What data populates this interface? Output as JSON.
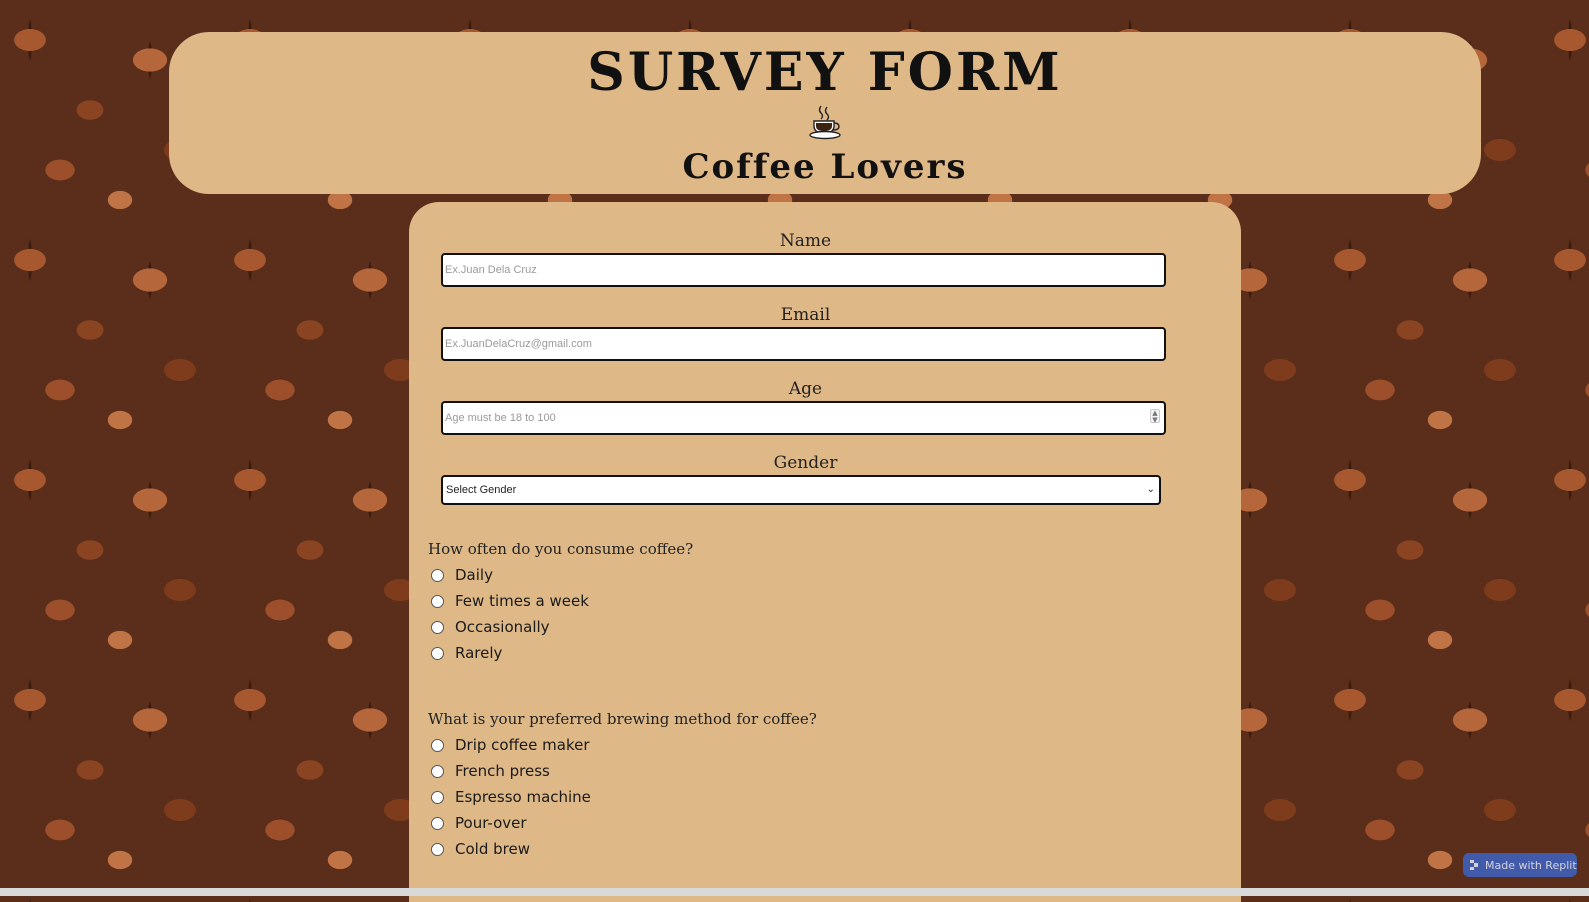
{
  "header": {
    "title": "SURVEY FORM",
    "icon": "coffee-cup-icon",
    "subtitle": "Coffee Lovers"
  },
  "form": {
    "name": {
      "label": "Name",
      "placeholder": "Ex.Juan Dela Cruz",
      "value": ""
    },
    "email": {
      "label": "Email",
      "placeholder": "Ex.JuanDelaCruz@gmail.com",
      "value": ""
    },
    "age": {
      "label": "Age",
      "placeholder": "Age must be 18 to 100",
      "value": ""
    },
    "gender": {
      "label": "Gender",
      "selected": "Select Gender"
    },
    "frequency": {
      "question": "How often do you consume coffee?",
      "options": [
        "Daily",
        "Few times a week",
        "Occasionally",
        "Rarely"
      ]
    },
    "brewing": {
      "question": "What is your preferred brewing method for coffee?",
      "options": [
        "Drip coffee maker",
        "French press",
        "Espresso machine",
        "Pour-over",
        "Cold brew"
      ]
    }
  },
  "badge": {
    "label": "Made with Replit"
  },
  "colors": {
    "card": "#deb887",
    "badge": "#3d64c4",
    "text": "#111111"
  }
}
